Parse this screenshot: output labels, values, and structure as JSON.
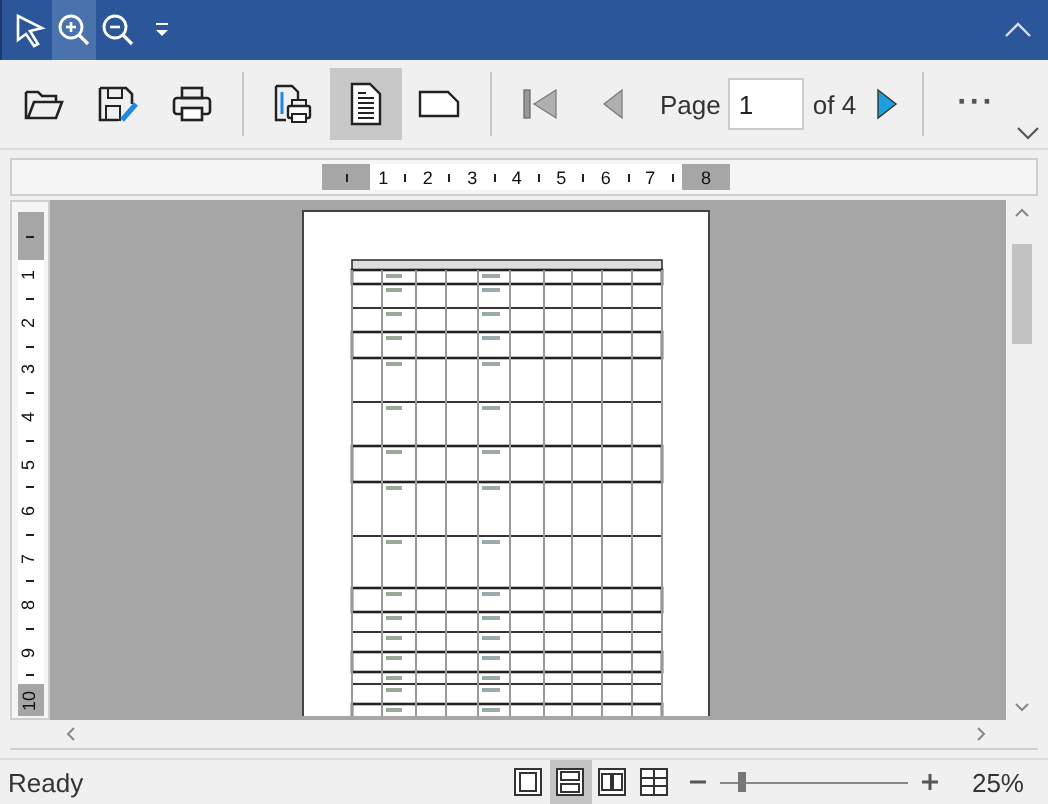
{
  "quick_access": [
    {
      "kind": "pointer",
      "selected": false
    },
    {
      "kind": "zoom-in",
      "selected": true
    },
    {
      "kind": "zoom-out",
      "selected": false
    },
    {
      "kind": "customize",
      "selected": false
    }
  ],
  "toolbar": {
    "file_buttons": [
      {
        "kind": "open"
      },
      {
        "kind": "save"
      },
      {
        "kind": "print"
      }
    ],
    "buttons": [
      {
        "kind": "page-setup",
        "selected": false
      },
      {
        "kind": "portrait",
        "selected": true
      },
      {
        "kind": "landscape",
        "selected": false
      }
    ],
    "nav_buttons": [
      {
        "kind": "first",
        "disabled": true
      },
      {
        "kind": "prev",
        "disabled": true
      }
    ],
    "page_label": "Page",
    "page_value": "1",
    "page_total": "of 4",
    "next": {
      "disabled": false
    },
    "more": "···"
  },
  "ruler_h": {
    "labels": [
      "1",
      "2",
      "3",
      "4",
      "5",
      "6",
      "7",
      "8"
    ]
  },
  "ruler_v": {
    "labels": [
      "1",
      "2",
      "3",
      "4",
      "5",
      "6",
      "7",
      "8",
      "9",
      "10"
    ]
  },
  "status_bar": {
    "text": "Ready",
    "views": [
      {
        "kind": "single",
        "selected": false
      },
      {
        "kind": "two-rows",
        "selected": true
      },
      {
        "kind": "two-cols",
        "selected": false
      },
      {
        "kind": "grid",
        "selected": false
      }
    ],
    "zoom": {
      "level": 0.12,
      "reading": "25%"
    }
  }
}
